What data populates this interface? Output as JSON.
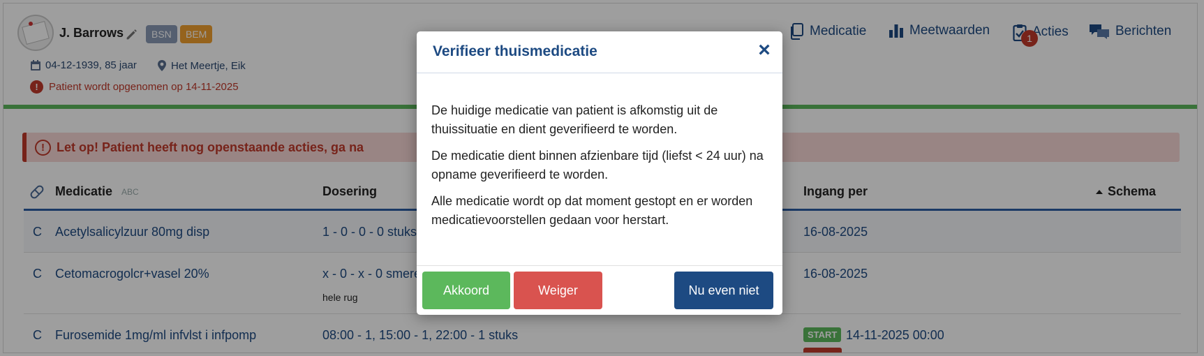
{
  "patient": {
    "name": "J. Barrows",
    "badges": {
      "bsn": "BSN",
      "bem": "BEM"
    },
    "dob": "04-12-1939, 85 jaar",
    "location": "Het Meertje, Eik",
    "admission_alert": "Patient wordt opgenomen op 14-11-2025"
  },
  "nav": {
    "medicatie": "Medicatie",
    "meetwaarden": "Meetwaarden",
    "acties": "Acties",
    "acties_count": "1",
    "berichten": "Berichten"
  },
  "warning": {
    "text": "Let op! Patient heeft nog openstaande acties, ga na"
  },
  "table": {
    "headers": {
      "medicatie": "Medicatie",
      "abc": "ABC",
      "dosering": "Dosering",
      "ingang": "Ingang per",
      "schema": "Schema"
    },
    "rows": [
      {
        "type": "C",
        "name": "Acetylsalicylzuur 80mg disp",
        "dosering": "1 - 0 - 0 - 0 stuks",
        "ingang": "16-08-2025"
      },
      {
        "type": "C",
        "name": "Cetomacrogolcr+vasel 20%",
        "dosering": "x - 0 - x - 0 smere",
        "note": "hele rug",
        "ingang": "16-08-2025"
      },
      {
        "type": "C",
        "name": "Furosemide 1mg/ml infvlst i infpomp",
        "dosering": "08:00 - 1, 15:00 - 1, 22:00 - 1 stuks",
        "badge": "START",
        "ingang": "14-11-2025 00:00"
      }
    ]
  },
  "modal": {
    "title": "Verifieer thuismedicatie",
    "close": "×",
    "paragraphs": [
      "De huidige medicatie van patient is afkomstig uit de thuissituatie en dient geverifieerd te worden.",
      "De medicatie dient binnen afzienbare tijd (liefst < 24 uur) na opname geverifieerd te worden.",
      "Alle medicatie wordt op dat moment gestopt en er worden medicatievoorstellen gedaan voor herstart."
    ],
    "buttons": {
      "akkoord": "Akkoord",
      "weiger": "Weiger",
      "niet": "Nu even niet"
    }
  },
  "colors": {
    "primary": "#1d4a82",
    "success": "#5cb85c",
    "danger": "#d9534f",
    "alert": "#c0392b",
    "warning_bg": "#f7d7d5",
    "badge_bsn": "#8a99b5",
    "badge_bem": "#f0a030"
  },
  "icons": [
    "edit-icon",
    "calendar-icon",
    "location-pin-icon",
    "exclamation-icon",
    "clipboard-copy-icon",
    "bar-chart-icon",
    "clipboard-check-icon",
    "chat-bubbles-icon",
    "pill-icon",
    "caret-up-icon",
    "close-icon"
  ]
}
